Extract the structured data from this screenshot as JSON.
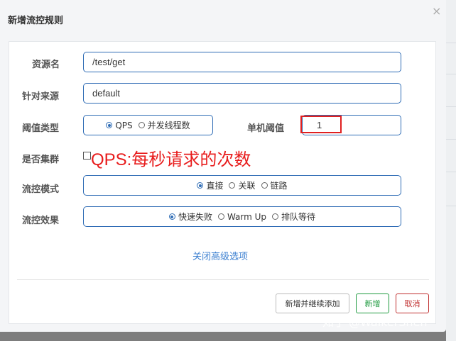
{
  "dialog": {
    "title": "新增流控规则",
    "close": "×"
  },
  "form": {
    "resource": {
      "label": "资源名",
      "value": "/test/get"
    },
    "source": {
      "label": "针对来源",
      "value": "default"
    },
    "threshold_type": {
      "label": "阈值类型",
      "options": [
        "QPS",
        "并发线程数"
      ],
      "selected": "QPS"
    },
    "single_threshold": {
      "label": "单机阈值",
      "value": "1"
    },
    "cluster": {
      "label": "是否集群",
      "checked": false
    },
    "mode": {
      "label": "流控模式",
      "options": [
        "直接",
        "关联",
        "链路"
      ],
      "selected": "直接"
    },
    "effect": {
      "label": "流控效果",
      "options": [
        "快速失败",
        "Warm Up",
        "排队等待"
      ],
      "selected": "快速失败"
    },
    "advanced_link": "关闭高级选项"
  },
  "annotation": {
    "text": "QPS:每秒请求的次数",
    "color": "#e81c1c"
  },
  "buttons": {
    "add_continue": "新增并继续添加",
    "add": "新增",
    "cancel": "取消"
  },
  "watermark": "知乎 @WalkerShen",
  "colors": {
    "accent": "#2f6cb5",
    "success": "#1e9a3f",
    "danger": "#c03030"
  }
}
